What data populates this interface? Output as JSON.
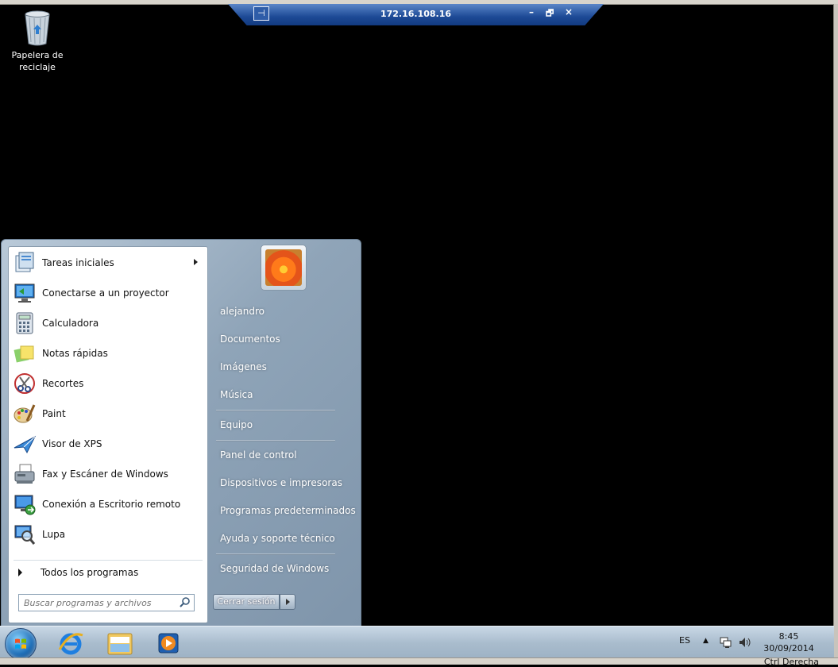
{
  "rdp_bar": {
    "title": "172.16.108.16",
    "pin_icon": "pin-icon",
    "minimize": "–",
    "restore": "🗗",
    "close": "×"
  },
  "desktop": {
    "recycle_bin": {
      "label_line1": "Papelera de",
      "label_line2": "reciclaje"
    }
  },
  "start_menu": {
    "programs": [
      {
        "label": "Tareas iniciales",
        "icon": "getting-started-icon",
        "has_submenu": true
      },
      {
        "label": "Conectarse a un proyector",
        "icon": "projector-icon"
      },
      {
        "label": "Calculadora",
        "icon": "calculator-icon"
      },
      {
        "label": "Notas rápidas",
        "icon": "sticky-notes-icon"
      },
      {
        "label": "Recortes",
        "icon": "snipping-tool-icon"
      },
      {
        "label": "Paint",
        "icon": "paint-icon"
      },
      {
        "label": "Visor de XPS",
        "icon": "xps-viewer-icon"
      },
      {
        "label": "Fax y Escáner de Windows",
        "icon": "fax-scanner-icon"
      },
      {
        "label": "Conexión a Escritorio remoto",
        "icon": "remote-desktop-icon"
      },
      {
        "label": "Lupa",
        "icon": "magnifier-icon"
      }
    ],
    "all_programs": "Todos los programas",
    "search_placeholder": "Buscar programas y archivos",
    "right": {
      "user": "alejandro",
      "documents": "Documentos",
      "pictures": "Imágenes",
      "music": "Música",
      "computer": "Equipo",
      "control_panel": "Panel de control",
      "devices": "Dispositivos e impresoras",
      "default_programs": "Programas predeterminados",
      "help": "Ayuda y soporte técnico",
      "security": "Seguridad de Windows"
    },
    "logoff": "Cerrar sesión"
  },
  "taskbar": {
    "pinned": [
      "internet-explorer-icon",
      "explorer-icon",
      "media-player-icon"
    ],
    "language": "ES",
    "clock_time": "8:45",
    "clock_date": "30/09/2014"
  },
  "host": {
    "status_text": "Ctrl Derecha"
  },
  "colors": {
    "rdp_bar": "#1d4a96",
    "taskbar": "#a9bccd",
    "start_menu": "#8fa4b8"
  }
}
